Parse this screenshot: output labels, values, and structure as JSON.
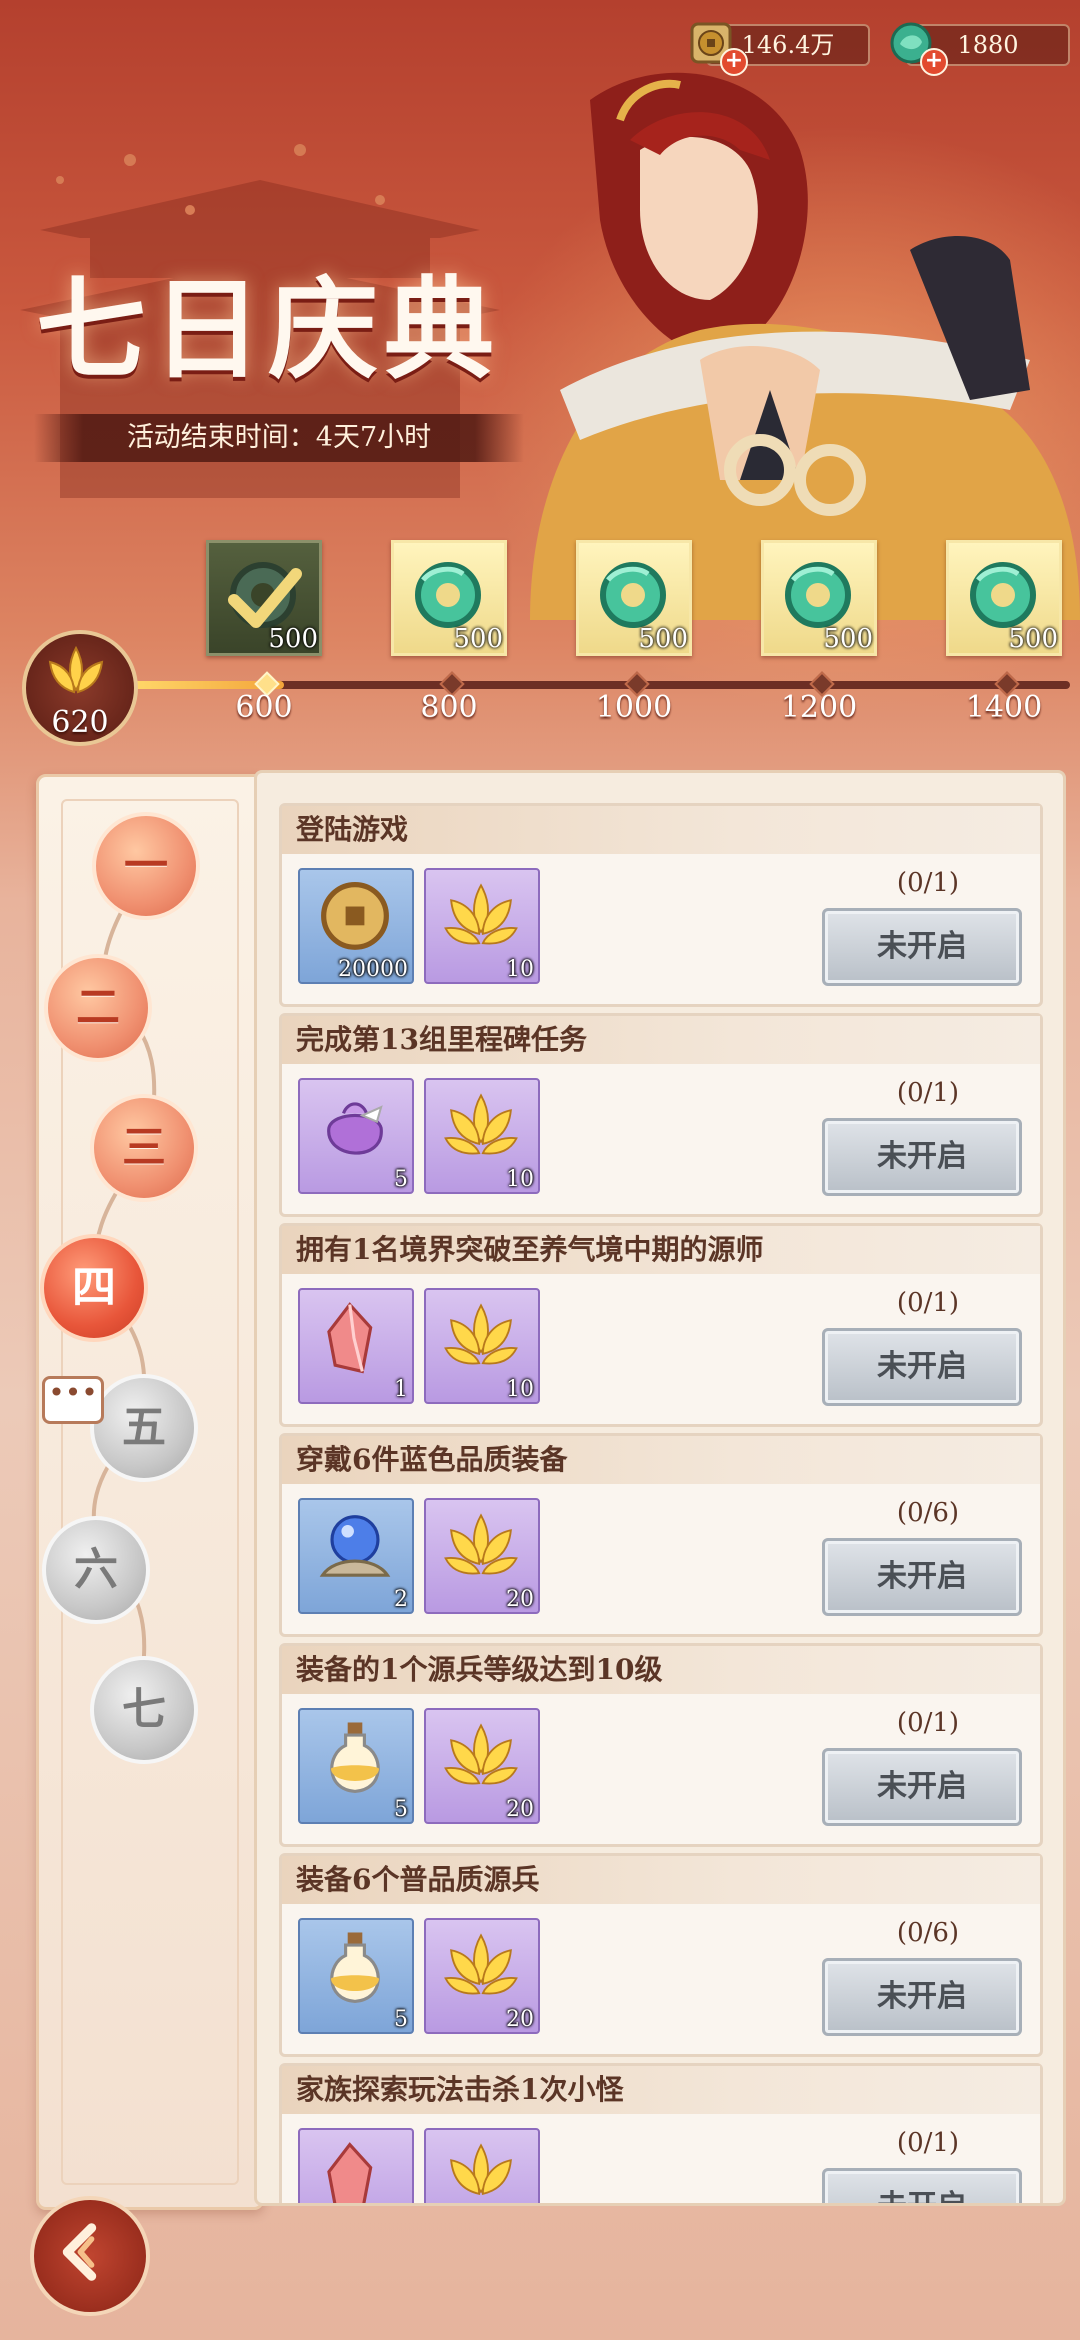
{
  "currency": {
    "coins": "146.4万",
    "jade": "1880"
  },
  "event": {
    "title": "七日庆典",
    "end_time": "活动结束时间：4天7小时"
  },
  "progress": {
    "current_points": "620",
    "current_value": 620,
    "max_value": 1400,
    "milestones": [
      {
        "value": "600",
        "reward_count": "500",
        "claimed": true
      },
      {
        "value": "800",
        "reward_count": "500",
        "claimed": false
      },
      {
        "value": "1000",
        "reward_count": "500",
        "claimed": false
      },
      {
        "value": "1200",
        "reward_count": "500",
        "claimed": false
      },
      {
        "value": "1400",
        "reward_count": "500",
        "claimed": false
      }
    ]
  },
  "days": [
    {
      "label": "一",
      "state": "open"
    },
    {
      "label": "二",
      "state": "open"
    },
    {
      "label": "三",
      "state": "open"
    },
    {
      "label": "四",
      "state": "active"
    },
    {
      "label": "五",
      "state": "locked"
    },
    {
      "label": "六",
      "state": "locked"
    },
    {
      "label": "七",
      "state": "locked"
    }
  ],
  "chat_icon": "chat-bubble-icon",
  "tasks": [
    {
      "title": "登陆游戏",
      "progress": "(0/1)",
      "button": "未开启",
      "rewards": [
        {
          "icon": "copper-coin-icon",
          "rarity": "blue",
          "qty": "20000"
        },
        {
          "icon": "golden-lotus-icon",
          "rarity": "purple",
          "qty": "10"
        }
      ]
    },
    {
      "title": "完成第13组里程碑任务",
      "progress": "(0/1)",
      "button": "未开启",
      "rewards": [
        {
          "icon": "pouch-icon",
          "rarity": "purple",
          "qty": "5"
        },
        {
          "icon": "golden-lotus-icon",
          "rarity": "purple",
          "qty": "10"
        }
      ]
    },
    {
      "title": "拥有1名境界突破至养气境中期的源师",
      "progress": "(0/1)",
      "button": "未开启",
      "rewards": [
        {
          "icon": "crystal-icon",
          "rarity": "purple",
          "qty": "1"
        },
        {
          "icon": "golden-lotus-icon",
          "rarity": "purple",
          "qty": "10"
        }
      ]
    },
    {
      "title": "穿戴6件蓝色品质装备",
      "progress": "(0/6)",
      "button": "未开启",
      "rewards": [
        {
          "icon": "orb-icon",
          "rarity": "blue",
          "qty": "2"
        },
        {
          "icon": "golden-lotus-icon",
          "rarity": "purple",
          "qty": "20"
        }
      ]
    },
    {
      "title": "装备的1个源兵等级达到10级",
      "progress": "(0/1)",
      "button": "未开启",
      "rewards": [
        {
          "icon": "potion-icon",
          "rarity": "blue",
          "qty": "5"
        },
        {
          "icon": "golden-lotus-icon",
          "rarity": "purple",
          "qty": "20"
        }
      ]
    },
    {
      "title": "装备6个普品质源兵",
      "progress": "(0/6)",
      "button": "未开启",
      "rewards": [
        {
          "icon": "potion-icon",
          "rarity": "blue",
          "qty": "5"
        },
        {
          "icon": "golden-lotus-icon",
          "rarity": "purple",
          "qty": "20"
        }
      ]
    },
    {
      "title": "家族探索玩法击杀1次小怪",
      "progress": "(0/1)",
      "button": "未开启",
      "rewards": [
        {
          "icon": "crystal-icon",
          "rarity": "purple",
          "qty": ""
        },
        {
          "icon": "golden-lotus-icon",
          "rarity": "purple",
          "qty": ""
        }
      ]
    }
  ]
}
